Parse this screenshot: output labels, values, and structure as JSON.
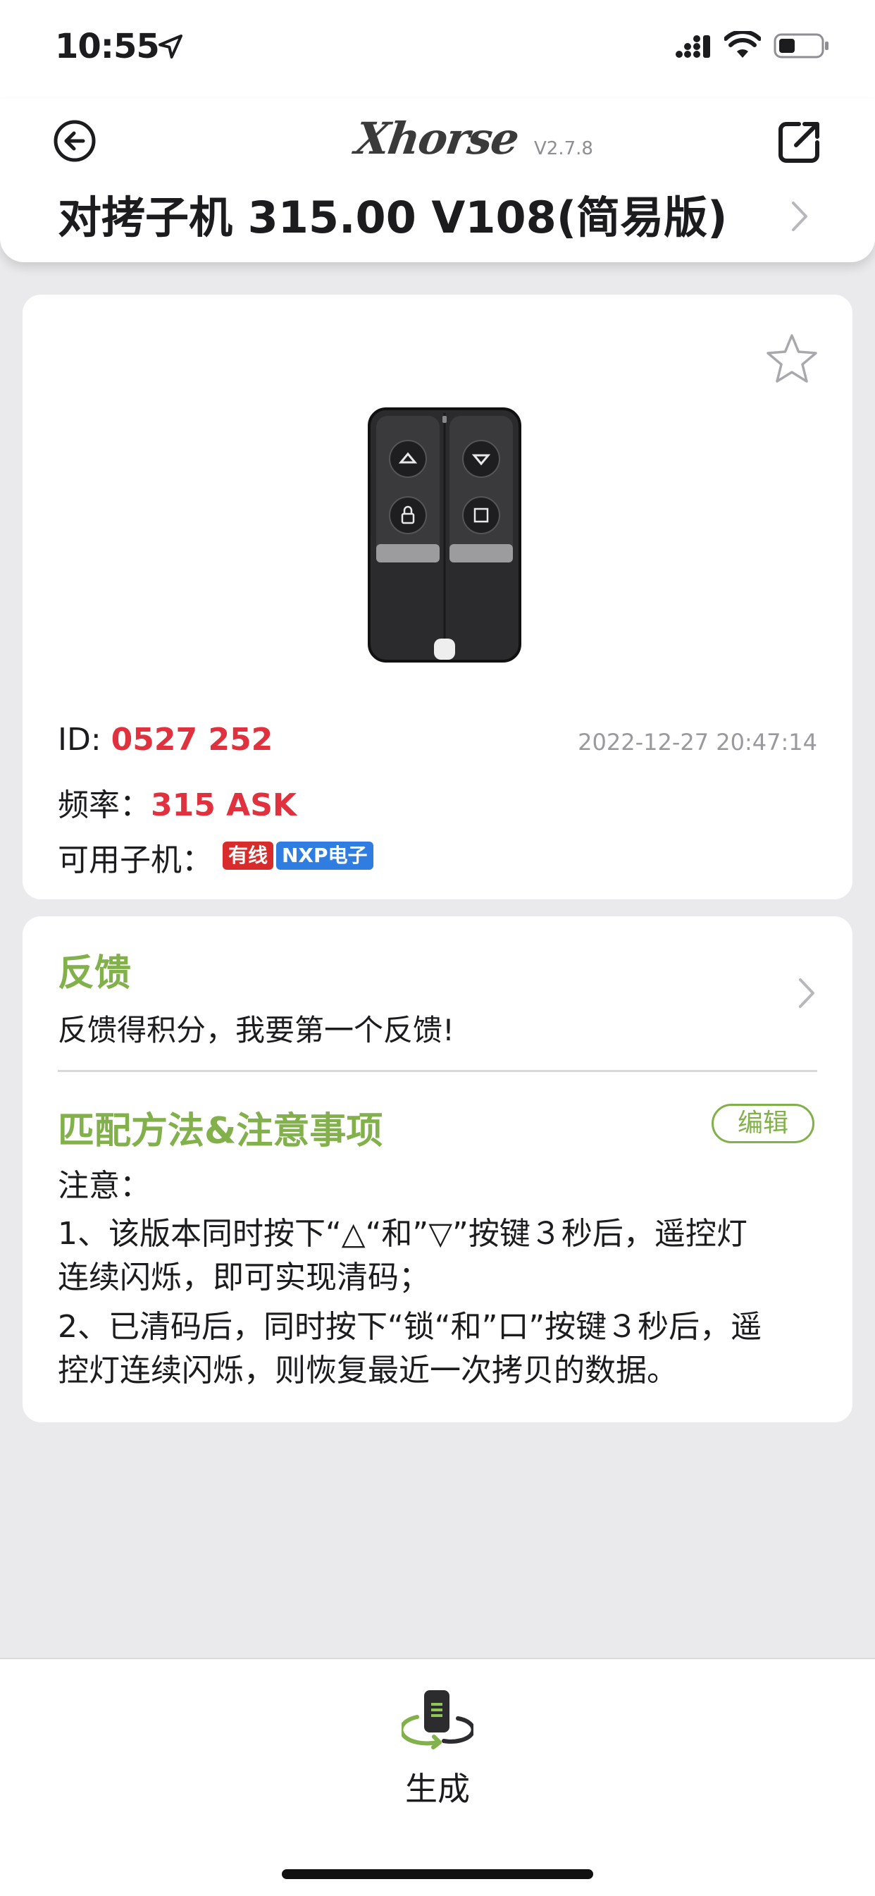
{
  "status_bar": {
    "time": "10:55",
    "location_icon": "location-arrow-icon",
    "signal_icon": "cellular-signal-icon",
    "wifi_icon": "wifi-icon",
    "battery_icon": "battery-low-icon"
  },
  "header": {
    "back_icon": "back-circle-arrow-icon",
    "logo": "Xhorse",
    "version": "V2.7.8",
    "share_icon": "share-external-icon",
    "title": "对拷子机 315.00 V108(简易版)",
    "chevron_icon": "chevron-right-icon"
  },
  "product": {
    "favorite_icon": "star-outline-icon",
    "image_icon": "remote-key-icon",
    "id_label": "ID: ",
    "id_value": "0527 252",
    "timestamp": "2022-12-27 20:47:14",
    "freq_label": "频率：",
    "freq_value": "315 ASK",
    "sub_label": "可用子机：",
    "badges": [
      "有线",
      "NXP电子"
    ]
  },
  "feedback": {
    "title": "反馈",
    "text": "反馈得积分，我要第一个反馈!",
    "chevron_icon": "chevron-right-icon"
  },
  "notes": {
    "title": "匹配方法&注意事项",
    "edit_label": "编辑",
    "lines": [
      "注意：",
      "1、该版本同时按下“△“和”▽”按键３秒后，遥控灯",
      "连续闪烁，即可实现清码；",
      "2、已清码后，同时按下“锁“和”口”按键３秒后，遥",
      "控灯连续闪烁，则恢复最近一次拷贝的数据。"
    ]
  },
  "bottom": {
    "generate_icon": "generate-remote-icon",
    "generate_label": "生成"
  },
  "colors": {
    "accent_green": "#82b04a",
    "id_red": "#e0323e",
    "badge_red": "#d82c2c",
    "badge_blue": "#2f7de1"
  }
}
